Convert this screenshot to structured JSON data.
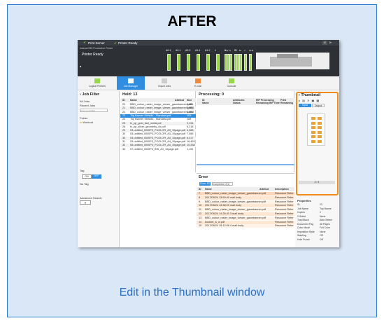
{
  "heading": "AFTER",
  "caption": "Edit in the Thumbnail window",
  "topbar": {
    "app": "Print Server",
    "status": "Printer Ready"
  },
  "printer": {
    "name": "Indexed760 Production Printer",
    "state": "Printer Ready",
    "trays": [
      "A0-1",
      "A2-1",
      "A2-2",
      "A1-1",
      "A1-2",
      "1",
      "2",
      "T1"
    ],
    "inks": [
      "SLV",
      "K",
      "C",
      "M",
      "Y",
      "CLR"
    ]
  },
  "nav": {
    "items": [
      "Logical Printers",
      "Job Manager",
      "Import Jobs",
      "E-mail",
      "Console"
    ]
  },
  "job_filter": {
    "title": "Job Filter",
    "all_jobs": "All Jobs",
    "recent": "Recent Jobs",
    "search_placeholder": "Enter a job filter",
    "folder": "Folder",
    "folder_item": "Workout",
    "tag": "Tag",
    "on": "ON",
    "off": "OFF",
    "no_tag": "No Tag",
    "advanced": "Advanced Search"
  },
  "held": {
    "title": "Held: 13",
    "cols": [
      "ID",
      "Name",
      "Attribut",
      "Size"
    ],
    "rows": [
      [
        "20",
        "BBD_colour_raster_image_viewer_gasmbanner.pdf0",
        "",
        "3,084"
      ],
      [
        "21",
        "BBD_colour_raster_image_viewer_gasmbanner.pdf01",
        "",
        "3,084"
      ],
      [
        "22",
        "BBD_colour_raster_image_viewer_gasmbanner.pdf02",
        "",
        "3,084"
      ],
      [
        "23",
        "Top Banner Metallic - Standard.pdf",
        "",
        "283"
      ],
      [
        "24",
        "Top Banner Metallic - Standard.pdf",
        "",
        "283"
      ],
      [
        "25",
        "fx_pp_gold_fact_metal.pdf",
        "",
        "2,194"
      ],
      [
        "26",
        "fx_pp_silver_geometry_4x.pdf",
        "",
        "6,218"
      ],
      [
        "29",
        "03-untitled_0000P3_PCOLOR_A3_10page.pdf",
        "",
        "4,388"
      ],
      [
        "30",
        "03-untitled_0000P3_PCOLOR_A3_10page.pdf",
        "",
        "7,085"
      ],
      [
        "30",
        "03-untitled_0000P3_PCOLOR_A4_10page.pdf",
        "",
        "6,417"
      ],
      [
        "31",
        "03-untitled_0000P3_PCOLOR_A4_10page.pdf",
        "",
        "16,493"
      ],
      [
        "32",
        "06-untitled_0000P3_PCOLOR_A4_10page.pdf",
        "",
        "10,338"
      ],
      [
        "33",
        "07-untitled_0000P3_BW_A4_10page.pdf",
        "",
        "1,151"
      ]
    ]
  },
  "processing": {
    "title": "Processing: 0",
    "cols": [
      "ID",
      "Name",
      "Attributes Status",
      "RIP Processing Remaining RIP Time",
      "Print Remaining"
    ]
  },
  "error": {
    "title": "Error",
    "tab_error": "Error: 16",
    "tab_completed": "Completed: 2(1)",
    "cols": [
      "ID",
      "Name",
      "Attribut",
      "Description"
    ],
    "rows": [
      [
        "7",
        "BBD_colour_raster_image_viewer_gasmbanner.pdf",
        "",
        "Resource Refer"
      ],
      [
        "8",
        "2017/08/24 13:59:40 mail body",
        "",
        "Resource Refer"
      ],
      [
        "9",
        "BBD_colour_raster_image_viewer_gasmbanner.pdf",
        "",
        "Resource Refer"
      ],
      [
        "10",
        "2017/08/24 13:38:09 mail body",
        "",
        "Resource Refer"
      ],
      [
        "11",
        "BBD_colour_raster_image_viewer_gasmbanner.pdf",
        "",
        "Resource Refer"
      ],
      [
        "12",
        "2017/08/24 14:28:40 3 mail body",
        "",
        "Resource Refer"
      ],
      [
        "13",
        "BBD_colour_raster_image_viewer_gasmbanner.pdf",
        "",
        "Resource Refer"
      ],
      [
        "14",
        "booklet_A_ui.pdf",
        "",
        "Resource Refer"
      ],
      [
        "15",
        "2017/08/24 15:12:06 4 mail body",
        "",
        "Resource Refer"
      ]
    ]
  },
  "thumbnail": {
    "title": "Thumbnail",
    "tab_input": "Input",
    "tab_output": "Output",
    "page": "4 / 4"
  },
  "properties": {
    "title": "Properties",
    "rows": [
      [
        "ID",
        "22"
      ],
      [
        "Job Name",
        "Top Banne"
      ],
      [
        "Copies",
        "1"
      ],
      [
        "2 Sided",
        "None"
      ],
      [
        "Tray/Stack",
        "Auto Select"
      ],
      [
        "Document Pag",
        "All Pages"
      ],
      [
        "Color Mode",
        "Full Color"
      ],
      [
        "Imposition Style",
        "None"
      ],
      [
        "Stapling",
        "Off"
      ],
      [
        "Hole Punch",
        "Off"
      ]
    ]
  }
}
